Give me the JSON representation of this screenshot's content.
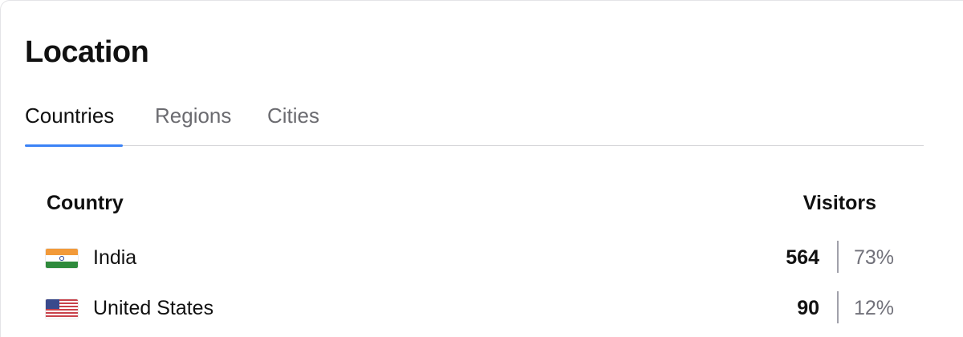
{
  "panel": {
    "title": "Location"
  },
  "tabs": [
    {
      "label": "Countries",
      "active": true
    },
    {
      "label": "Regions",
      "active": false
    },
    {
      "label": "Cities",
      "active": false
    }
  ],
  "table": {
    "columns": [
      "Country",
      "Visitors"
    ],
    "rows": [
      {
        "flag_icon": "india-flag-icon",
        "country": "India",
        "visitors": "564",
        "percent": "73%"
      },
      {
        "flag_icon": "united-states-flag-icon",
        "country": "United States",
        "visitors": "90",
        "percent": "12%"
      }
    ]
  },
  "colors": {
    "accent": "#3b82f6",
    "text": "#111111",
    "muted": "#71717a"
  }
}
